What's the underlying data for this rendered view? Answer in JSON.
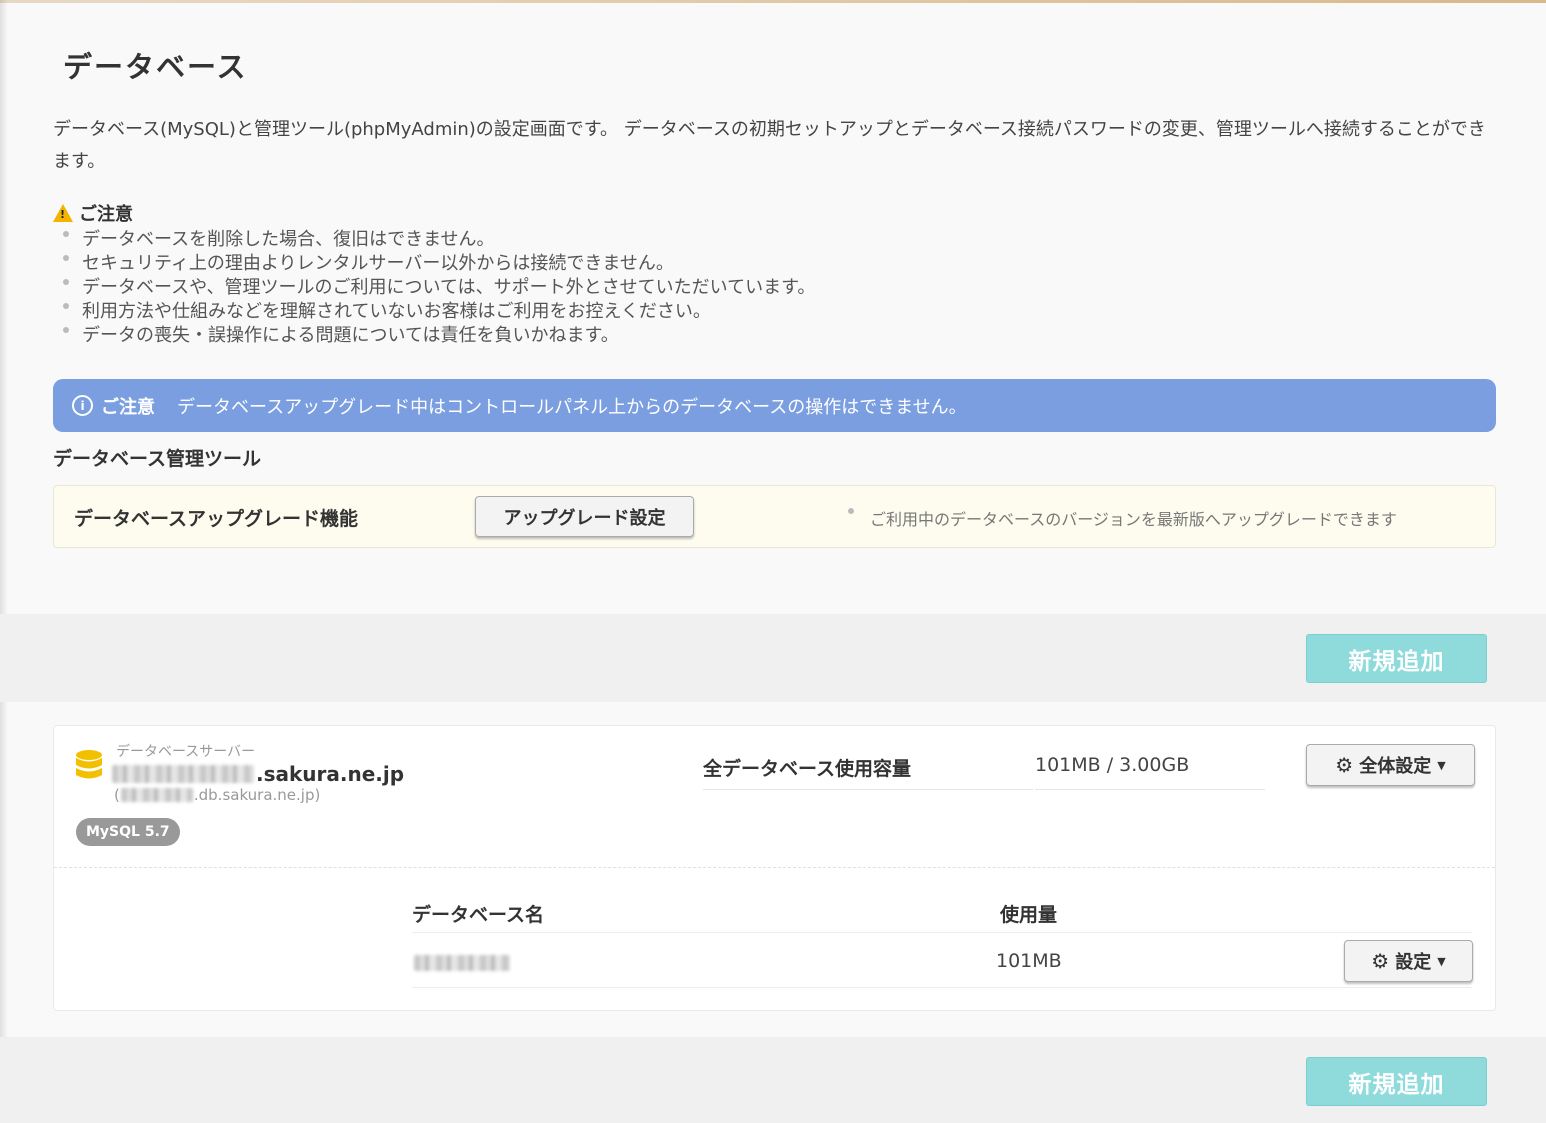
{
  "page": {
    "title": "データベース",
    "intro": "データベース(MySQL)と管理ツール(phpMyAdmin)の設定画面です。 データベースの初期セットアップとデータベース接続パスワードの変更、管理ツールへ接続することができます。"
  },
  "caution": {
    "heading": "ご注意",
    "items": [
      "データベースを削除した場合、復旧はできません。",
      "セキュリティ上の理由よりレンタルサーバー以外からは接続できません。",
      "データベースや、管理ツールのご利用については、サポート外とさせていただいています。",
      "利用方法や仕組みなどを理解されていないお客様はご利用をお控えください。",
      "データの喪失・誤操作による問題については責任を負いかねます。"
    ]
  },
  "notice": {
    "label": "ご注意",
    "text": "データベースアップグレード中はコントロールパネル上からのデータベースの操作はできません。"
  },
  "tools": {
    "title": "データベース管理ツール",
    "upgrade_label": "データベースアップグレード機能",
    "upgrade_button": "アップグレード設定",
    "upgrade_note": "ご利用中のデータベースのバージョンを最新版へアップグレードできます"
  },
  "add_button": "新規追加",
  "server": {
    "caption": "データベースサーバー",
    "host_suffix": ".sakura.ne.jp",
    "sub_prefix": "(",
    "sub_suffix": ".db.sakura.ne.jp)",
    "version_badge": "MySQL 5.7",
    "usage_label": "全データベース使用容量",
    "usage_value": "101MB / 3.00GB",
    "all_settings_button": "全体設定",
    "columns": {
      "name": "データベース名",
      "usage": "使用量"
    },
    "databases": [
      {
        "usage": "101MB",
        "settings_button": "設定"
      }
    ]
  },
  "colors": {
    "notice_bg": "#7a9ee0",
    "add_button_bg": "#8fdbdc",
    "db_icon": "#f3c000",
    "badge_bg": "#999999"
  }
}
